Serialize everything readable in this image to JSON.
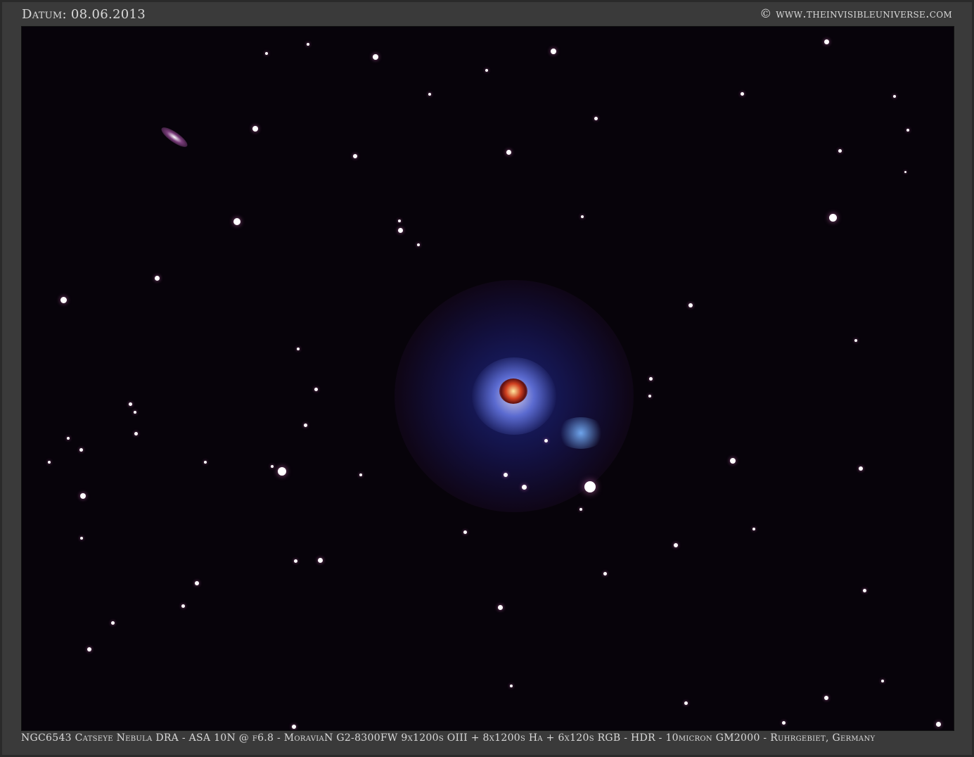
{
  "header": {
    "date_label": "Datum: 08.06.2013",
    "copyright": "© www.theinvisibleuniverse.com"
  },
  "caption": "NGC6543 Catseye Nebula DRA - ASA 10N @ f6.8 - MoraviaN G2-8300FW 9x1200s OIII + 8x1200s Ha + 6x120s RGB - HDR - 10micron GM2000 - Ruhrgebiet, Germany",
  "colors": {
    "frame": "#3a3a3a",
    "sky": "#07030a",
    "nebula": "#3a5cff",
    "core": "#c0301a"
  }
}
